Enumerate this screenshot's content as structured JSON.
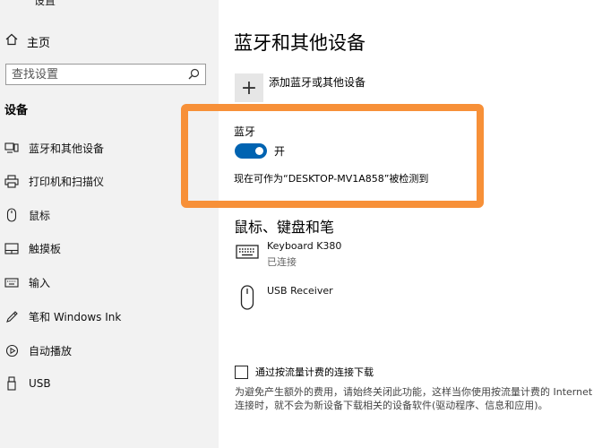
{
  "sidebar": {
    "settings_title": "设置",
    "home_label": "主页",
    "search_placeholder": "查找设置",
    "section_label": "设备",
    "items": [
      {
        "label": "蓝牙和其他设备",
        "icon": "bluetooth-devices-icon"
      },
      {
        "label": "打印机和扫描仪",
        "icon": "printer-icon"
      },
      {
        "label": "鼠标",
        "icon": "mouse-icon"
      },
      {
        "label": "触摸板",
        "icon": "touchpad-icon"
      },
      {
        "label": "输入",
        "icon": "keyboard-icon"
      },
      {
        "label": "笔和 Windows Ink",
        "icon": "pen-icon"
      },
      {
        "label": "自动播放",
        "icon": "autoplay-icon"
      },
      {
        "label": "USB",
        "icon": "usb-icon"
      }
    ]
  },
  "main": {
    "title": "蓝牙和其他设备",
    "add_device_label": "添加蓝牙或其他设备",
    "bluetooth": {
      "label": "蓝牙",
      "state": "开",
      "discoverable_text": "现在可作为“DESKTOP-MV1A858”被检测到"
    },
    "mouse_section_title": "鼠标、键盘和笔",
    "devices": [
      {
        "name": "Keyboard K380",
        "status": "已连接",
        "icon": "keyboard-icon"
      },
      {
        "name": "USB Receiver",
        "status": "",
        "icon": "mouse-icon"
      }
    ],
    "metered": {
      "label": "通过按流量计费的连接下载",
      "description": "为避免产生额外的费用，请始终关闭此功能，这样当你使用按流量计费的 Internet 连接时，就不会为新设备下载相关的设备软件(驱动程序、信息和应用)。"
    }
  },
  "colors": {
    "accent": "#0063b1",
    "highlight": "#f79038",
    "sidebar_bg": "#f2f2f2"
  }
}
